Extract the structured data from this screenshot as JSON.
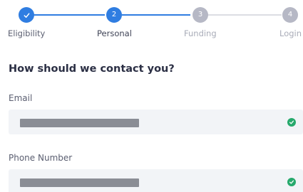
{
  "stepper": {
    "steps": [
      {
        "label": "Eligibility",
        "number": "",
        "status": "done"
      },
      {
        "label": "Personal",
        "number": "2",
        "status": "active"
      },
      {
        "label": "Funding",
        "number": "3",
        "status": "pending"
      },
      {
        "label": "Login",
        "number": "4",
        "status": "pending"
      }
    ]
  },
  "form": {
    "heading": "How should we contact you?",
    "email": {
      "label": "Email",
      "value": "",
      "valid": true
    },
    "phone": {
      "label": "Phone Number",
      "value": "",
      "valid": true
    }
  },
  "colors": {
    "accent": "#2f7de1",
    "pending": "#b6b8c5",
    "success": "#26a96c",
    "field_bg": "#f2f4f7"
  }
}
